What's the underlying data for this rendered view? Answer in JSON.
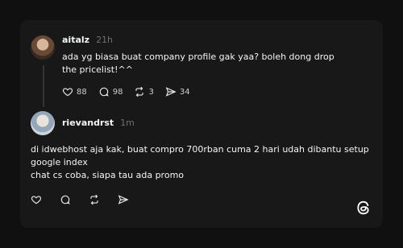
{
  "post": {
    "username": "aitalz",
    "time": "21h",
    "text": "ada yg biasa buat company profile gak yaa? boleh dong drop\nthe pricelist!^^",
    "actions": {
      "likes": "88",
      "comments": "98",
      "reposts": "3",
      "shares": "34"
    }
  },
  "reply": {
    "username": "rievandrst",
    "time": "1m",
    "text": "di idwebhost aja kak, buat compro 700rban cuma 2 hari udah dibantu setup\ngoogle index\nchat cs coba, siapa tau ada promo"
  },
  "icons": {
    "like": "heart-icon",
    "comment": "comment-icon",
    "repost": "repost-icon",
    "share": "send-icon",
    "brand": "threads-logo-icon"
  },
  "colors": {
    "background": "#101010",
    "card": "#181818",
    "text": "#f3f5f7",
    "muted": "#6f6f6f"
  }
}
